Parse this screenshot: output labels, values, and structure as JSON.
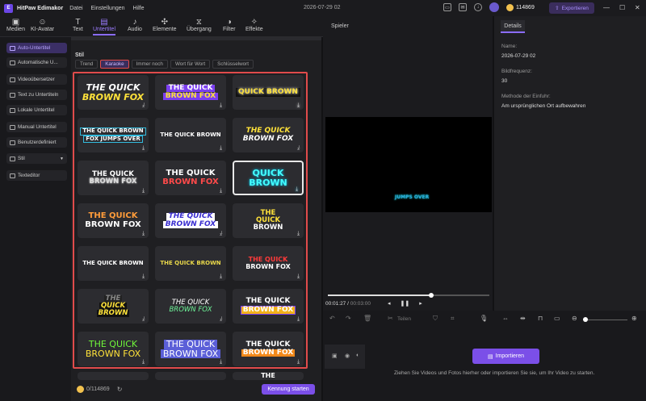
{
  "app": {
    "name": "HitPaw Edimakor",
    "menu": [
      "Datei",
      "Einstellungen",
      "Hilfe"
    ],
    "date": "2026-07-29 02",
    "credits": "114869",
    "export_label": "Exportieren"
  },
  "toolbar": {
    "items": [
      {
        "label": "Medien",
        "icon": "media-icon"
      },
      {
        "label": "KI-Avatar",
        "icon": "avatar-icon"
      },
      {
        "label": "Text",
        "icon": "text-icon"
      },
      {
        "label": "Untertitel",
        "icon": "subtitle-icon"
      },
      {
        "label": "Audio",
        "icon": "audio-icon"
      },
      {
        "label": "Elemente",
        "icon": "elements-icon"
      },
      {
        "label": "Übergang",
        "icon": "transition-icon"
      },
      {
        "label": "Filter",
        "icon": "filter-icon"
      },
      {
        "label": "Effekte",
        "icon": "effects-icon"
      }
    ],
    "active": "Untertitel"
  },
  "sidebar": {
    "items": [
      {
        "label": "Auto-Untertitel",
        "active": true
      },
      {
        "label": "Automatische U..."
      },
      {
        "label": "Videoübersetzer"
      },
      {
        "label": "Text zu Untertiteln"
      },
      {
        "label": "Lokale Untertitel"
      },
      {
        "label": "Manual Untertitel"
      },
      {
        "label": "Benutzerdefiniert"
      },
      {
        "label": "Stil",
        "dropdown": true
      },
      {
        "label": "Texteditor"
      }
    ]
  },
  "panel": {
    "section_title": "Stil",
    "tabs": [
      "Trend",
      "Karaoke",
      "Immer noch",
      "Wort für Wort",
      "Schlüsselwort"
    ],
    "active_tab": "Karaoke",
    "credits": "0/114869",
    "start_button": "Kennung starten"
  },
  "styles": [
    {
      "lines": [
        "THE QUICK",
        "BROWN FOX"
      ]
    },
    {
      "lines": [
        "THE QUICK",
        "BROWN FOX"
      ]
    },
    {
      "lines": [
        "QUICK BROWN"
      ]
    },
    {
      "lines": [
        "THE QUICK BROWN",
        "FOX JUMPS OVER"
      ]
    },
    {
      "lines": [
        "THE QUICK BROWN"
      ]
    },
    {
      "lines": [
        "THE QUICK",
        "BROWN FOX"
      ]
    },
    {
      "lines": [
        "THE QUICK",
        "BROWN FOX"
      ]
    },
    {
      "lines": [
        "THE QUICK",
        "BROWN FOX"
      ]
    },
    {
      "lines": [
        "QUICK BROWN"
      ]
    },
    {
      "lines": [
        "THE QUICK",
        "BROWN FOX"
      ]
    },
    {
      "lines": [
        "THE QUICK",
        "BROWN FOX"
      ]
    },
    {
      "lines": [
        "THE",
        "QUICK",
        "BROWN"
      ]
    },
    {
      "lines": [
        "THE QUICK BROWN"
      ]
    },
    {
      "lines": [
        "THE QUICK BROWN"
      ]
    },
    {
      "lines": [
        "THE QUICK",
        "BROWN FOX"
      ]
    },
    {
      "lines": [
        "THE",
        "QUICK",
        "BROWN"
      ]
    },
    {
      "lines": [
        "THE QUICK",
        "BROWN FOX"
      ]
    },
    {
      "lines": [
        "THE QUICK",
        "BROWN FOX"
      ]
    },
    {
      "lines": [
        "THE QUICK",
        "BROWN FOX"
      ]
    },
    {
      "lines": [
        "THE QUICK",
        "BROWN FOX"
      ]
    },
    {
      "lines": [
        "THE QUICK",
        "BROWN FOX"
      ]
    },
    {
      "lines": [
        ""
      ]
    },
    {
      "lines": [
        ""
      ]
    },
    {
      "lines": [
        "THE"
      ]
    }
  ],
  "player": {
    "title": "Spieler",
    "caption": "JUMPS OVER",
    "time_current": "00:01:27",
    "time_total": "00:03:00",
    "progress": 0.64
  },
  "details": {
    "tab": "Details",
    "fields": [
      {
        "label": "Name:",
        "value": "2026-07-29 02"
      },
      {
        "label": "Bildfrequenz:",
        "value": "30"
      },
      {
        "label": "Methode der Einfuhr:",
        "value": "Am ursprünglichen Ort aufbewahren"
      }
    ]
  },
  "timeline": {
    "split_label": "Teilen",
    "import_label": "Importieren",
    "hint": "Ziehen Sie Videos und Fotos hierher oder importieren Sie sie, um Ihr Video zu starten."
  }
}
